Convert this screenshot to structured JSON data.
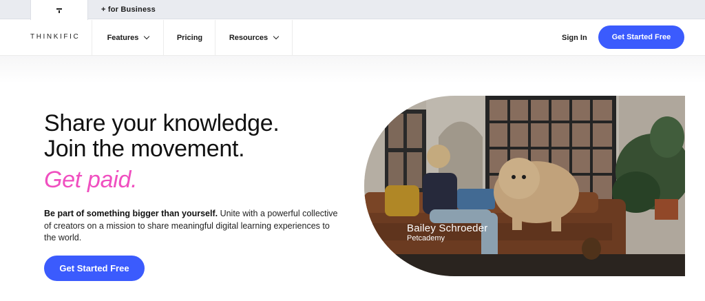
{
  "topbar": {
    "home_tab_icon": "thinkific-mark-icon",
    "business_tab_label": "+ for Business"
  },
  "nav": {
    "logo_text": "THINKIFIC",
    "items": [
      {
        "label": "Features",
        "icon": "chevron-down-icon"
      },
      {
        "label": "Pricing"
      },
      {
        "label": "Resources",
        "icon": "chevron-down-icon"
      }
    ],
    "sign_in_label": "Sign In",
    "cta_label": "Get Started Free"
  },
  "hero": {
    "line1": "Share your knowledge.",
    "line2": "Join the movement.",
    "line3": "Get paid.",
    "desc_bold": "Be part of something bigger than yourself.",
    "desc_rest": " Unite with a powerful collective of creators on a mission to share meaningful digital learning experiences to the world.",
    "cta_label": "Get Started Free",
    "caption_name": "Bailey Schroeder",
    "caption_org": "Petcademy"
  },
  "colors": {
    "accent": "#3b5bfd",
    "highlight": "#f04fc0"
  }
}
